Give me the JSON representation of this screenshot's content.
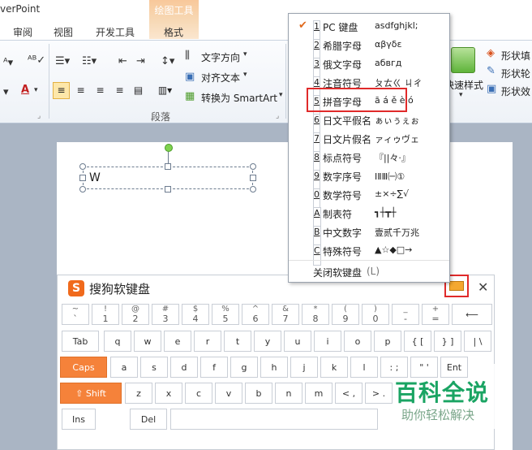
{
  "app": {
    "title": "verPoint"
  },
  "context_tab": {
    "label": "绘图工具",
    "sub": "格式"
  },
  "tabs": [
    "审阅",
    "视图",
    "开发工具"
  ],
  "ribbon": {
    "text_direction": "文字方向",
    "align_text": "对齐文本",
    "convert_smartart": "转换为 SmartArt",
    "group_paragraph": "段落",
    "quick_styles": "快速样式",
    "shape_fill": "形状填",
    "shape_outline": "形状轮",
    "shape_effects": "形状效"
  },
  "textbox": {
    "text": "W"
  },
  "menu": {
    "items": [
      {
        "key": "1",
        "label": "PC 键盘",
        "sample": "asdfghjkl;",
        "checked": true
      },
      {
        "key": "2",
        "label": "希腊字母",
        "sample": "αβγδε"
      },
      {
        "key": "3",
        "label": "俄文字母",
        "sample": "абвгд"
      },
      {
        "key": "4",
        "label": "注音符号",
        "sample": "ㄆㄊㄍ ㄐㄔ"
      },
      {
        "key": "5",
        "label": "拼音字母",
        "sample": "ā á ě è ó",
        "highlighted": true
      },
      {
        "key": "6",
        "label": "日文平假名",
        "sample": "ぁぃぅぇぉ"
      },
      {
        "key": "7",
        "label": "日文片假名",
        "sample": "ァィゥヴェ"
      },
      {
        "key": "8",
        "label": "标点符号",
        "sample": "『||々·』"
      },
      {
        "key": "9",
        "label": "数字序号",
        "sample": "ⅠⅡⅢ㈠①"
      },
      {
        "key": "0",
        "label": "数学符号",
        "sample": "±×÷∑√"
      },
      {
        "key": "A",
        "label": "制表符",
        "sample": "┓┼┳┼"
      },
      {
        "key": "B",
        "label": "中文数字",
        "sample": "壹贰千万兆"
      },
      {
        "key": "C",
        "label": "特殊符号",
        "sample": "▲☆◆□→"
      }
    ],
    "close_label": "关闭软键盘",
    "close_shortcut": "(L)"
  },
  "keyboard": {
    "title": "搜狗软键盘",
    "logo": "S",
    "close": "✕",
    "row1": [
      {
        "top": "~",
        "bot": "`"
      },
      {
        "top": "!",
        "bot": "1"
      },
      {
        "top": "@",
        "bot": "2"
      },
      {
        "top": "#",
        "bot": "3"
      },
      {
        "top": "$",
        "bot": "4"
      },
      {
        "top": "%",
        "bot": "5"
      },
      {
        "top": "^",
        "bot": "6"
      },
      {
        "top": "&",
        "bot": "7"
      },
      {
        "top": "*",
        "bot": "8"
      },
      {
        "top": "(",
        "bot": "9"
      },
      {
        "top": ")",
        "bot": "0"
      },
      {
        "top": "_",
        "bot": "-"
      },
      {
        "top": "+",
        "bot": "="
      },
      {
        "top": "",
        "bot": "⟵"
      }
    ],
    "row2": [
      "Tab",
      "q",
      "w",
      "e",
      "r",
      "t",
      "y",
      "u",
      "i",
      "o",
      "p",
      "{ [",
      "} ]",
      "| \\"
    ],
    "row3": [
      "Caps",
      "a",
      "s",
      "d",
      "f",
      "g",
      "h",
      "j",
      "k",
      "l",
      ": ;",
      "\" '",
      "Ent"
    ],
    "row4": [
      "⇧ Shift",
      "z",
      "x",
      "c",
      "v",
      "b",
      "n",
      "m",
      "< ,",
      "> ."
    ],
    "row5": [
      "Ins",
      "Del"
    ]
  },
  "watermark": {
    "title": "百科全说",
    "subtitle": "助你轻松解决"
  },
  "colors": {
    "accent": "#f5823a",
    "highlight": "#e02a2a",
    "watermark": "#1aa463"
  }
}
